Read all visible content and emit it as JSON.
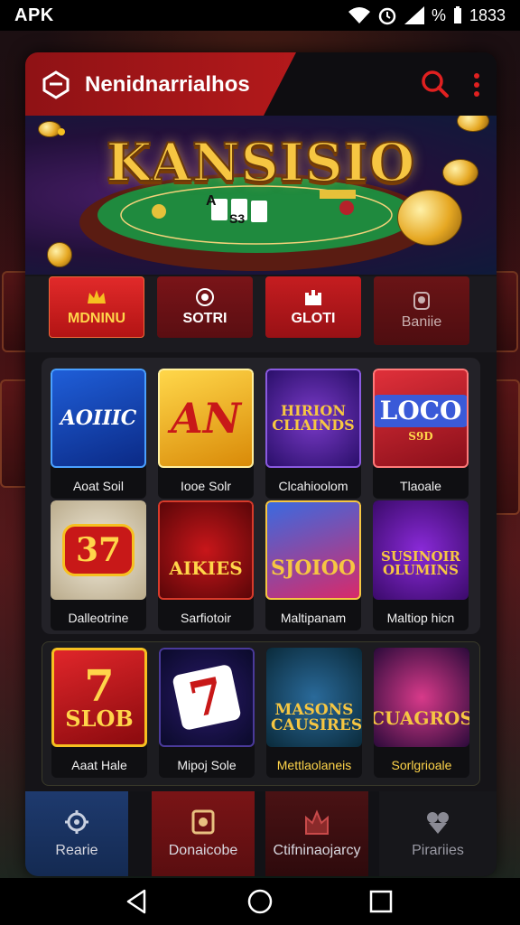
{
  "status_bar": {
    "carrier": "APK",
    "battery": "%",
    "time": "1833"
  },
  "header": {
    "title": "Nenidnarrialhos"
  },
  "hero": {
    "title": "KANSISIO",
    "table_text_1": "A",
    "table_text_2": "S3"
  },
  "tabs": [
    {
      "label": "MDNINU",
      "icon": "crown-icon"
    },
    {
      "label": "SOTRI",
      "icon": "chip-icon"
    },
    {
      "label": "GLOTI",
      "icon": "castle-icon"
    },
    {
      "label": "Baniie",
      "icon": "badge-icon"
    }
  ],
  "games_row1": [
    {
      "label": "Aoat Soil",
      "art": "AOIIIC",
      "icon": "wings-icon"
    },
    {
      "label": "Iooe Solr",
      "art": "AN",
      "icon": "slot-icon"
    },
    {
      "label": "Clcahioolom",
      "art": "HIRION CLIAINDS",
      "icon": "emblem-icon"
    },
    {
      "label": "Tlaoale",
      "art": "LOCO",
      "sub": "S9D",
      "icon": "frame-icon"
    }
  ],
  "games_row2": [
    {
      "label": "Dalleotrine",
      "art": "37",
      "icon": "slot-machine-icon"
    },
    {
      "label": "Sarfiotoir",
      "art": "AIKIES",
      "icon": "tiger-icon"
    },
    {
      "label": "Maltipanam",
      "art": "SJOIOO",
      "icon": "character-icon"
    },
    {
      "label": "Maltiop hicn",
      "art": "SUSINOIR OLUMINS",
      "icon": "character-icon"
    }
  ],
  "games_row3": [
    {
      "label": "Aaat Hale",
      "art": "7",
      "art_sub": "SLOB",
      "icon": "seven-icon"
    },
    {
      "label": "Mipoj Sole",
      "art": "7",
      "icon": "seven-card-icon"
    },
    {
      "label": "Mettlaolaneis",
      "art": "MASONS CAUSIRES",
      "icon": "fox-icon"
    },
    {
      "label": "Sorlgrioale",
      "art": "CUAGROS",
      "icon": "dog-icon"
    }
  ],
  "bottom_nav": [
    {
      "label": "Rearie",
      "icon": "home-icon"
    },
    {
      "label": "Donaicobe",
      "icon": "bonus-icon"
    },
    {
      "label": "Ctifninaojarcy",
      "icon": "champion-icon"
    },
    {
      "label": "Pirariies",
      "icon": "favorites-icon"
    }
  ],
  "colors": {
    "accent_red": "#b3191b",
    "gold": "#f6c642",
    "header_dark": "#0e0d11"
  }
}
